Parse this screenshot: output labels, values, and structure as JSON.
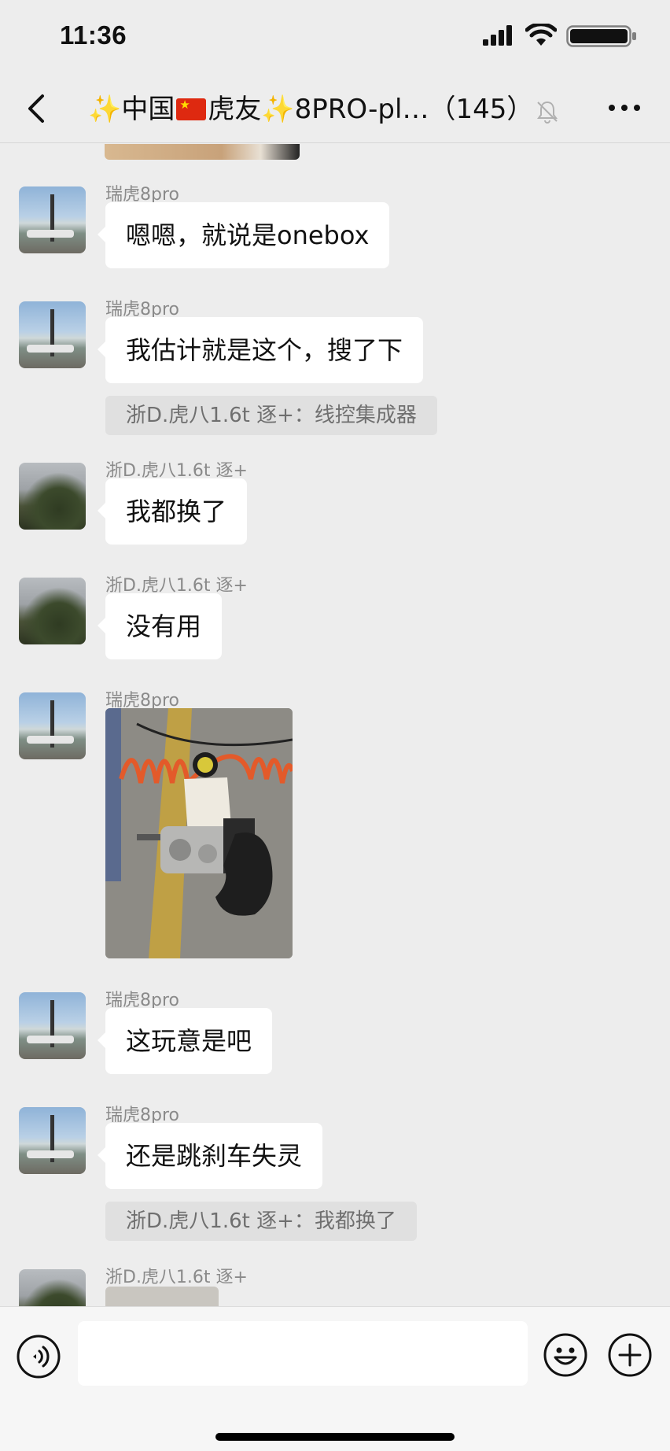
{
  "status_bar": {
    "time": "11:36"
  },
  "header": {
    "title_prefix": "✨中国",
    "title_middle": "虎友",
    "title_suffix": "✨8PRO-pl…（145）",
    "icons": [
      "back-icon",
      "mute-icon",
      "more-icon"
    ]
  },
  "messages": [
    {
      "sender": "瑞虎8pro",
      "text": "嗯嗯，就说是onebox"
    },
    {
      "sender": "瑞虎8pro",
      "text": "我估计就是这个，搜了下",
      "quote": "浙D.虎八1.6t 逐+：线控集成器"
    },
    {
      "sender": "浙D.虎八1.6t 逐+",
      "text": "我都换了"
    },
    {
      "sender": "浙D.虎八1.6t 逐+",
      "text": "没有用"
    },
    {
      "sender": "瑞虎8pro",
      "image": "car-brake-unit-photo"
    },
    {
      "sender": "瑞虎8pro",
      "text": "这玩意是吧"
    },
    {
      "sender": "瑞虎8pro",
      "text": "还是跳刹车失灵",
      "quote": "浙D.虎八1.6t 逐+：我都换了"
    },
    {
      "sender": "浙D.虎八1.6t 逐+",
      "image": "partial-photo"
    }
  ],
  "input_bar": {
    "placeholder": "",
    "icons": [
      "voice-icon",
      "emoji-icon",
      "plus-icon"
    ]
  },
  "colors": {
    "background": "#ededed",
    "bubble": "#ffffff",
    "quote_bg": "#e0e0e0",
    "sender_text": "#8a8a8a"
  }
}
